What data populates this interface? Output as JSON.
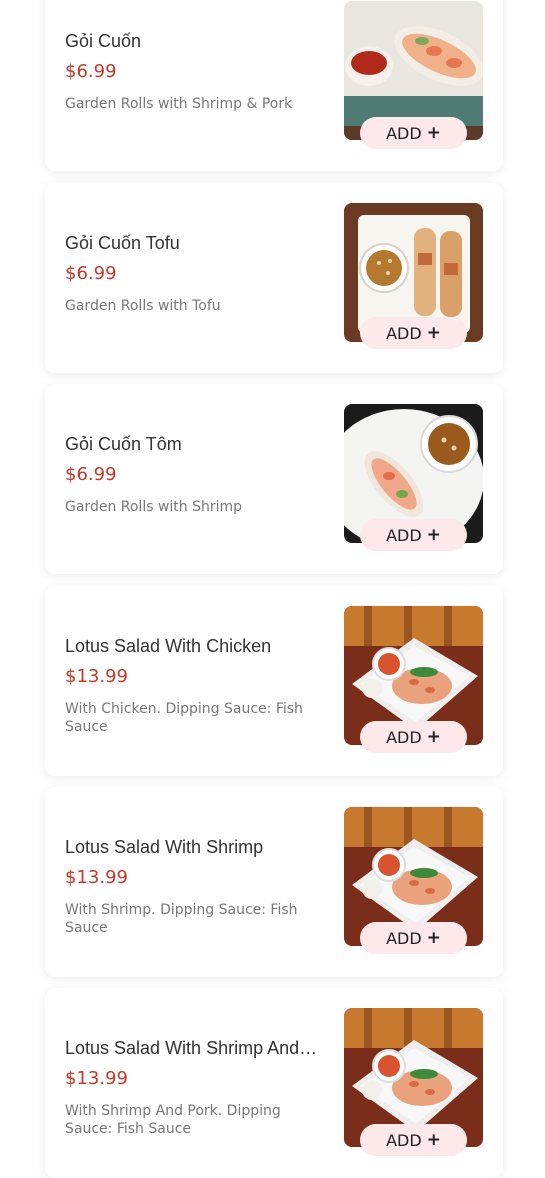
{
  "menu": {
    "add_label": "ADD",
    "plus_icon": "plus-icon",
    "accent_color": "#c0392b",
    "button_color": "#fde8ea",
    "items": [
      {
        "name": "Gỏi Cuốn",
        "price": "$6.99",
        "description": "Garden Rolls with Shrimp & Pork",
        "image": "spring-rolls-photo"
      },
      {
        "name": "Gỏi Cuốn Tofu",
        "price": "$6.99",
        "description": "Garden Rolls with Tofu",
        "image": "tofu-rolls-photo"
      },
      {
        "name": "Gỏi Cuốn Tôm",
        "price": "$6.99",
        "description": "Garden Rolls with Shrimp",
        "image": "shrimp-rolls-photo"
      },
      {
        "name": "Lotus Salad With Chicken",
        "price": "$13.99",
        "description": "With Chicken. Dipping Sauce: Fish Sauce",
        "image": "lotus-salad-photo"
      },
      {
        "name": "Lotus Salad With Shrimp",
        "price": "$13.99",
        "description": "With Shrimp. Dipping Sauce: Fish Sauce",
        "image": "lotus-salad-photo"
      },
      {
        "name": "Lotus Salad With Shrimp And…",
        "price": "$13.99",
        "description": "With Shrimp And Pork. Dipping Sauce: Fish Sauce",
        "image": "lotus-salad-photo"
      }
    ]
  }
}
